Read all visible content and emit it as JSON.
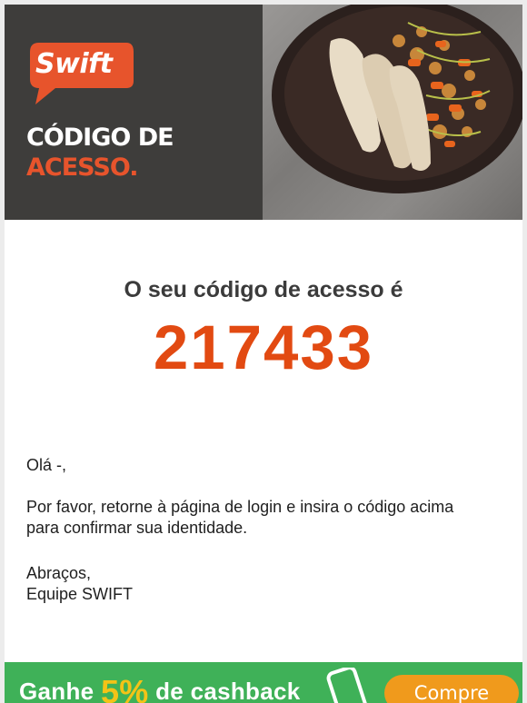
{
  "hero": {
    "logo_text": "Swift",
    "title_line1": "CÓDIGO DE",
    "title_line2": "ACESSO."
  },
  "message": {
    "intro": "O seu código de acesso é",
    "code": "217433",
    "greeting": "Olá -,",
    "paragraph": "Por favor, retorne à página de login e insira o código acima para confirmar sua identidade.",
    "signoff": "Abraços,",
    "team": "Equipe SWIFT"
  },
  "banner": {
    "text_before": "Ganhe ",
    "percent": "5%",
    "text_after": " de cashback",
    "cta_label": "Compre Agora"
  },
  "colors": {
    "brand_orange": "#e24a12",
    "banner_green": "#3fb158",
    "cta_orange": "#f09a1c",
    "hero_dark": "#3e3d3b"
  }
}
